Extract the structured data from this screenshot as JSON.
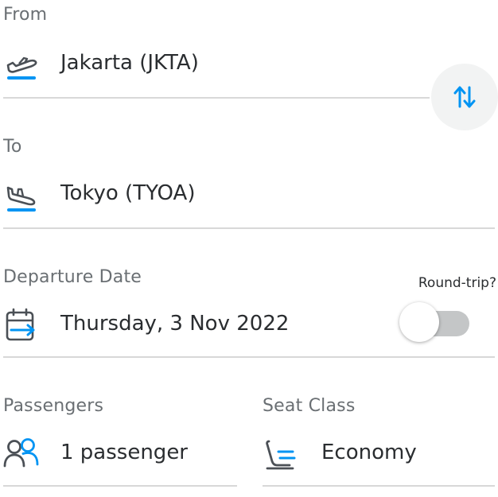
{
  "from": {
    "label": "From",
    "value": "Jakarta (JKTA)",
    "icon": "airplane-takeoff-icon"
  },
  "swap": {
    "icon": "swap-vertical-icon"
  },
  "to": {
    "label": "To",
    "value": "Tokyo (TYOA)",
    "icon": "airplane-landing-icon"
  },
  "departure": {
    "label": "Departure Date",
    "value": "Thursday, 3 Nov 2022",
    "icon": "calendar-depart-icon"
  },
  "round_trip": {
    "label": "Round-trip?",
    "enabled": false
  },
  "passengers": {
    "label": "Passengers",
    "value": "1 passenger",
    "icon": "people-icon"
  },
  "seat_class": {
    "label": "Seat Class",
    "value": "Economy",
    "icon": "seat-icon"
  },
  "colors": {
    "accent": "#0194f3",
    "icon_dark": "#4b5056",
    "label": "#6a6f73",
    "value": "#2a2d30",
    "divider": "#d8d8d8",
    "swap_bg": "#f2f3f3",
    "toggle_track_off": "#c4c6c7"
  }
}
